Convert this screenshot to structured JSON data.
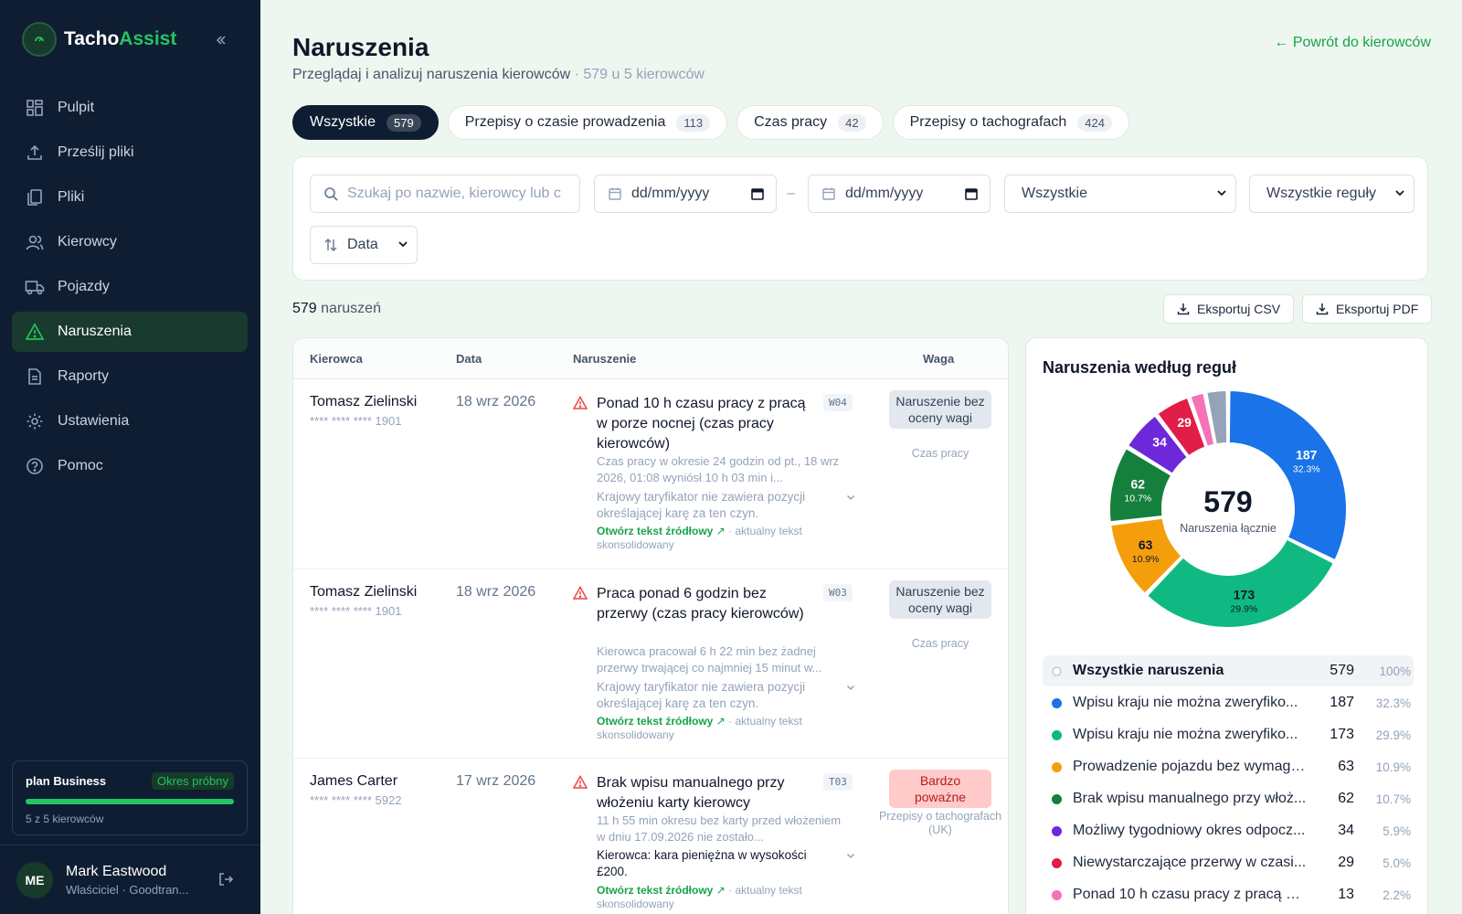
{
  "brand": {
    "name_main": "Tacho",
    "name_accent": "Assist"
  },
  "nav": [
    {
      "label": "Pulpit",
      "icon": "grid-icon",
      "active": false
    },
    {
      "label": "Prześlij pliki",
      "icon": "upload-icon",
      "active": false
    },
    {
      "label": "Pliki",
      "icon": "files-icon",
      "active": false
    },
    {
      "label": "Kierowcy",
      "icon": "users-icon",
      "active": false
    },
    {
      "label": "Pojazdy",
      "icon": "truck-icon",
      "active": false
    },
    {
      "label": "Naruszenia",
      "icon": "warning-icon",
      "active": true
    },
    {
      "label": "Raporty",
      "icon": "report-icon",
      "active": false
    },
    {
      "label": "Ustawienia",
      "icon": "gear-icon",
      "active": false
    },
    {
      "label": "Pomoc",
      "icon": "help-icon",
      "active": false
    }
  ],
  "plan": {
    "name": "plan Business",
    "badge": "Okres próbny",
    "usage": "5 z 5 kierowców",
    "fill_fraction": 1.0
  },
  "user": {
    "initials": "ME",
    "name": "Mark Eastwood",
    "role": "Właściciel · Goodtran..."
  },
  "header": {
    "title": "Naruszenia",
    "subtitle": "Przeglądaj i analizuj naruszenia kierowców",
    "subtitle_meta": "· 579 u 5 kierowców",
    "back_link": "← Powrót do kierowców"
  },
  "tabs": [
    {
      "label": "Wszystkie",
      "count": "579",
      "active": true
    },
    {
      "label": "Przepisy o czasie prowadzenia",
      "count": "113",
      "active": false
    },
    {
      "label": "Czas pracy",
      "count": "42",
      "active": false
    },
    {
      "label": "Przepisy o tachografach",
      "count": "424",
      "active": false
    }
  ],
  "filters": {
    "search_placeholder": "Szukaj po nazwie, kierowcy lub c",
    "date_from": "dd/mm/yyyy",
    "date_dash": "–",
    "date_to": "dd/mm/yyyy",
    "severity_select": "Wszystkie",
    "rules_select": "Wszystkie reguły",
    "sort_label": "Data"
  },
  "results": {
    "count": "579",
    "count_suffix": "naruszeń"
  },
  "export": {
    "csv": "Eksportuj CSV",
    "pdf": "Eksportuj PDF"
  },
  "table": {
    "headers": {
      "driver": "Kierowca",
      "date": "Data",
      "violation": "Naruszenie",
      "severity": "Waga"
    },
    "rows": [
      {
        "driver": "Tomasz Zielinski",
        "card": "**** **** **** 1901",
        "date": "18 wrz 2026",
        "title": "Ponad 10 h czasu pracy z pracą w porze nocnej (czas pracy kierowców)",
        "code": "W04",
        "description": "Czas pracy w okresie 24 godzin od pt., 18 wrz 2026, 01:08 wyniósł 10 h 03 min i...",
        "penalty": "Krajowy taryfikator nie zawiera pozycji określającej karę za ten czyn.",
        "source_link": "Otwórz tekst źródłowy",
        "source_note": "· aktualny tekst skonsolidowany",
        "severity": "Naruszenie bez oceny wagi",
        "category": "Czas pracy"
      },
      {
        "driver": "Tomasz Zielinski",
        "card": "**** **** **** 1901",
        "date": "18 wrz 2026",
        "title": "Praca ponad 6 godzin bez przerwy (czas pracy kierowców)",
        "code": "W03",
        "description": "Kierowca pracował 6 h 22 min bez żadnej przerwy trwającej co najmniej 15 minut w...",
        "penalty": "Krajowy taryfikator nie zawiera pozycji określającej karę za ten czyn.",
        "source_link": "Otwórz tekst źródłowy",
        "source_note": "· aktualny tekst skonsolidowany",
        "severity": "Naruszenie bez oceny wagi",
        "category": "Czas pracy"
      },
      {
        "driver": "James Carter",
        "card": "**** **** **** 5922",
        "date": "17 wrz 2026",
        "title": "Brak wpisu manualnego przy włożeniu karty kierowcy",
        "code": "T03",
        "description": "11 h 55 min okresu bez karty przed włożeniem w dniu 17.09.2026 nie zostało...",
        "penalty": "Kierowca: kara pieniężna w wysokości £200.",
        "source_link": "Otwórz tekst źródłowy",
        "source_note": "· aktualny tekst skonsolidowany",
        "severity": "Bardzo poważne",
        "category": "Przepisy o tachografach (UK)"
      }
    ]
  },
  "chart_data": {
    "type": "pie",
    "title": "Naruszenia według reguł",
    "center_value": "579",
    "center_label": "Naruszenia łącznie",
    "total_row": {
      "label": "Wszystkie naruszenia",
      "count": "579",
      "pct": "100%"
    },
    "slices": [
      {
        "label": "Wpisu kraju nie można zweryfiko...",
        "value": 187,
        "pct": "32.3%",
        "color": "#1a73e8"
      },
      {
        "label": "Wpisu kraju nie można zweryfiko...",
        "value": 173,
        "pct": "29.9%",
        "color": "#10b981"
      },
      {
        "label": "Prowadzenie pojazdu bez wymaga...",
        "value": 63,
        "pct": "10.9%",
        "color": "#f59e0b"
      },
      {
        "label": "Brak wpisu manualnego przy włoż...",
        "value": 62,
        "pct": "10.7%",
        "color": "#15803d"
      },
      {
        "label": "Możliwy tygodniowy okres odpocz...",
        "value": 34,
        "pct": "5.9%",
        "color": "#6d28d9"
      },
      {
        "label": "Niewystarczające przerwy w czasi...",
        "value": 29,
        "pct": "5.0%",
        "color": "#e11d48"
      },
      {
        "label": "Ponad 10 h czasu pracy z pracą w ...",
        "value": 13,
        "pct": "2.2%",
        "color": "#f472b6"
      },
      {
        "label": "",
        "value": 18,
        "pct": "",
        "color": "#94a3b8"
      }
    ]
  },
  "colors": {
    "sidebar": "#0f1d33",
    "accent": "#22c55e",
    "active_nav": "#193a2e",
    "severity_red_bg": "#fecaca"
  }
}
